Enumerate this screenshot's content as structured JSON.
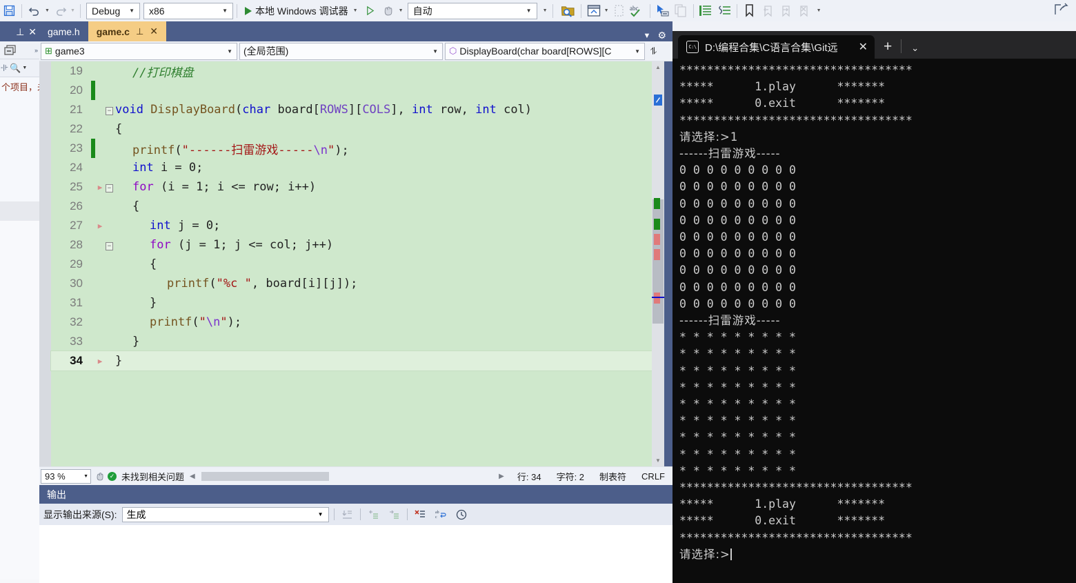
{
  "toolbar": {
    "save_all_icon": "save-all-icon",
    "undo_label": "撤消",
    "redo_label": "恢复",
    "config_combo": {
      "value": "Debug",
      "name": "solution-configuration"
    },
    "platform_combo": {
      "value": "x86",
      "name": "solution-platform"
    },
    "run_label": "本地 Windows 调试器",
    "attach_label": "附加",
    "process_combo": {
      "value": "自动",
      "name": "process-combo"
    },
    "icons": [
      "find-in-files-icon",
      "new-window-icon",
      "spell-check-icon",
      "pointer-select-icon",
      "copy-icon",
      "increase-indent-icon",
      "comment-icon",
      "uncomment-icon",
      "toggle-bookmark-icon",
      "previous-bookmark-icon",
      "next-bookmark-icon",
      "clear-bookmarks-icon",
      "overflow-icon",
      "share-icon"
    ]
  },
  "solution_explorer": {
    "pin_label": "⊥",
    "close_label": "✕",
    "text": "个项目，未"
  },
  "editor": {
    "tabs": [
      {
        "label": "game.h",
        "active": false
      },
      {
        "label": "game.c",
        "active": true,
        "pin": "⊥",
        "close": "✕"
      }
    ],
    "nav": {
      "project": "game3",
      "scope": "(全局范围)",
      "member": "DisplayBoard(char board[ROWS][C"
    },
    "lines": [
      {
        "num": "19",
        "change": "",
        "bp": "",
        "fold": "",
        "indent": 1,
        "tokens": [
          {
            "t": "//打印棋盘",
            "c": "k-cmt"
          }
        ]
      },
      {
        "num": "20",
        "change": "green",
        "bp": "",
        "fold": "",
        "indent": 0,
        "tokens": []
      },
      {
        "num": "21",
        "change": "",
        "bp": "",
        "fold": "−",
        "indent": 0,
        "tokens": [
          {
            "t": "void ",
            "c": "k-blue"
          },
          {
            "t": "DisplayBoard",
            "c": "k-fn"
          },
          {
            "t": "(",
            "c": "k-plain"
          },
          {
            "t": "char",
            "c": "k-blue"
          },
          {
            "t": " board[",
            "c": "k-plain"
          },
          {
            "t": "ROWS",
            "c": "k-macro"
          },
          {
            "t": "][",
            "c": "k-plain"
          },
          {
            "t": "COLS",
            "c": "k-macro"
          },
          {
            "t": "], ",
            "c": "k-plain"
          },
          {
            "t": "int",
            "c": "k-blue"
          },
          {
            "t": " row, ",
            "c": "k-plain"
          },
          {
            "t": "int",
            "c": "k-blue"
          },
          {
            "t": " col)",
            "c": "k-plain"
          }
        ]
      },
      {
        "num": "22",
        "change": "",
        "bp": "",
        "fold": "",
        "indent": 0,
        "tokens": [
          {
            "t": "{",
            "c": "k-plain"
          }
        ]
      },
      {
        "num": "23",
        "change": "green",
        "bp": "",
        "fold": "",
        "indent": 1,
        "tokens": [
          {
            "t": "printf",
            "c": "k-fn"
          },
          {
            "t": "(",
            "c": "k-plain"
          },
          {
            "t": "\"------扫雷游戏-----",
            "c": "k-str"
          },
          {
            "t": "\\n",
            "c": "k-esc"
          },
          {
            "t": "\"",
            "c": "k-str"
          },
          {
            "t": ");",
            "c": "k-plain"
          }
        ]
      },
      {
        "num": "24",
        "change": "",
        "bp": "",
        "fold": "",
        "indent": 1,
        "tokens": [
          {
            "t": "int",
            "c": "k-blue"
          },
          {
            "t": " i = 0;",
            "c": "k-plain"
          }
        ]
      },
      {
        "num": "25",
        "change": "",
        "bp": "▶",
        "fold": "−",
        "indent": 1,
        "tokens": [
          {
            "t": "for",
            "c": "k-purple"
          },
          {
            "t": " (i = 1; i <= row; i++)",
            "c": "k-plain"
          }
        ]
      },
      {
        "num": "26",
        "change": "",
        "bp": "",
        "fold": "",
        "indent": 1,
        "tokens": [
          {
            "t": "{",
            "c": "k-plain"
          }
        ]
      },
      {
        "num": "27",
        "change": "",
        "bp": "▶",
        "fold": "",
        "indent": 2,
        "tokens": [
          {
            "t": "int",
            "c": "k-blue"
          },
          {
            "t": " j = 0;",
            "c": "k-plain"
          }
        ]
      },
      {
        "num": "28",
        "change": "",
        "bp": "",
        "fold": "−",
        "indent": 2,
        "tokens": [
          {
            "t": "for",
            "c": "k-purple"
          },
          {
            "t": " (j = 1; j <= col; j++)",
            "c": "k-plain"
          }
        ]
      },
      {
        "num": "29",
        "change": "",
        "bp": "",
        "fold": "",
        "indent": 2,
        "tokens": [
          {
            "t": "{",
            "c": "k-plain"
          }
        ]
      },
      {
        "num": "30",
        "change": "",
        "bp": "",
        "fold": "",
        "indent": 3,
        "tokens": [
          {
            "t": "printf",
            "c": "k-fn"
          },
          {
            "t": "(",
            "c": "k-plain"
          },
          {
            "t": "\"",
            "c": "k-str"
          },
          {
            "t": "%c",
            "c": "k-str"
          },
          {
            "t": " \"",
            "c": "k-str"
          },
          {
            "t": ", board[i][j]);",
            "c": "k-plain"
          }
        ]
      },
      {
        "num": "31",
        "change": "",
        "bp": "",
        "fold": "",
        "indent": 2,
        "tokens": [
          {
            "t": "}",
            "c": "k-plain"
          }
        ]
      },
      {
        "num": "32",
        "change": "",
        "bp": "",
        "fold": "",
        "indent": 2,
        "tokens": [
          {
            "t": "printf",
            "c": "k-fn"
          },
          {
            "t": "(",
            "c": "k-plain"
          },
          {
            "t": "\"",
            "c": "k-str"
          },
          {
            "t": "\\n",
            "c": "k-esc"
          },
          {
            "t": "\"",
            "c": "k-str"
          },
          {
            "t": ");",
            "c": "k-plain"
          }
        ]
      },
      {
        "num": "33",
        "change": "",
        "bp": "",
        "fold": "",
        "indent": 1,
        "tokens": [
          {
            "t": "}",
            "c": "k-plain"
          }
        ]
      },
      {
        "num": "34",
        "change": "",
        "bp": "▶",
        "fold": "",
        "indent": 0,
        "current": true,
        "tokens": [
          {
            "t": "}",
            "c": "k-plain"
          }
        ]
      }
    ],
    "status": {
      "zoom": "93 %",
      "issues": "未找到相关问题",
      "line": "行: 34",
      "char": "字符: 2",
      "tabs": "制表符",
      "eol": "CRLF"
    }
  },
  "output": {
    "title": "输出",
    "source_label": "显示输出来源(S):",
    "source_value": "生成",
    "icons": [
      "go-to-message-icon",
      "previous-message-icon",
      "next-message-icon",
      "clear-all-icon",
      "toggle-wordwrap-icon",
      "show-timestamps-icon"
    ]
  },
  "terminal": {
    "tab_title": "D:\\编程合集\\C语言合集\\Git远",
    "tab_icon": "cmd-icon",
    "close_label": "✕",
    "new_tab_label": "+",
    "dropdown_label": "⌄",
    "lines": [
      "**********************************",
      "*****      1.play      *******",
      "*****      0.exit      *******",
      "**********************************",
      "请选择:>1",
      "------扫雷游戏-----",
      "0 0 0 0 0 0 0 0 0 ",
      "0 0 0 0 0 0 0 0 0 ",
      "0 0 0 0 0 0 0 0 0 ",
      "0 0 0 0 0 0 0 0 0 ",
      "0 0 0 0 0 0 0 0 0 ",
      "0 0 0 0 0 0 0 0 0 ",
      "0 0 0 0 0 0 0 0 0 ",
      "0 0 0 0 0 0 0 0 0 ",
      "0 0 0 0 0 0 0 0 0 ",
      "------扫雷游戏-----",
      "* * * * * * * * * ",
      "* * * * * * * * * ",
      "* * * * * * * * * ",
      "* * * * * * * * * ",
      "* * * * * * * * * ",
      "* * * * * * * * * ",
      "* * * * * * * * * ",
      "* * * * * * * * * ",
      "* * * * * * * * * ",
      "**********************************",
      "*****      1.play      *******",
      "*****      0.exit      *******",
      "**********************************",
      "请选择:>"
    ],
    "cursor_on_last": true
  },
  "colors": {
    "vs_blue": "#4c5e8a",
    "active_tab": "#f5cd85",
    "editor_bg": "#cfe8cc",
    "terminal_bg": "#0c0c0c",
    "terminal_fg": "#cccccc"
  }
}
